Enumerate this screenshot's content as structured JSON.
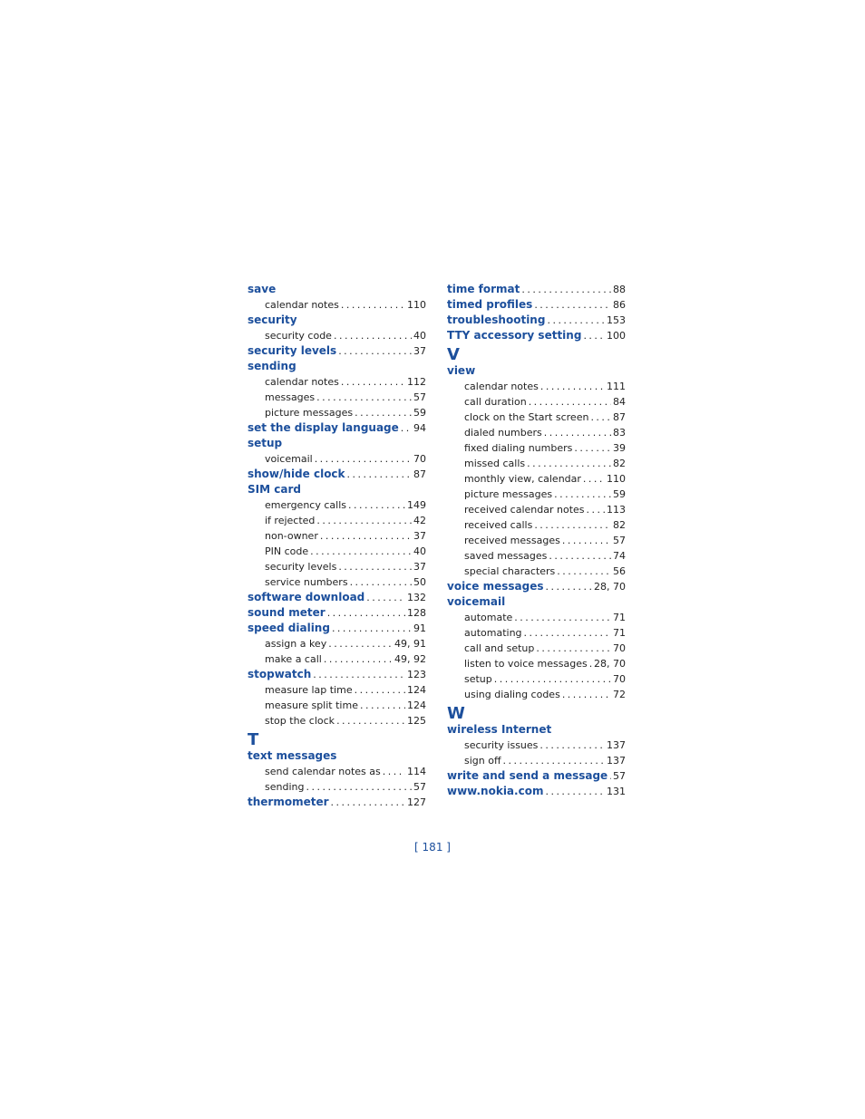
{
  "colors": {
    "heading": "#1c4f9c",
    "text": "#222222"
  },
  "page_number": "[ 181 ]",
  "columns": [
    {
      "entries": [
        {
          "type": "main",
          "term": "save",
          "page": ""
        },
        {
          "type": "sub",
          "term": "calendar notes",
          "page": "110"
        },
        {
          "type": "main",
          "term": "security",
          "page": ""
        },
        {
          "type": "sub",
          "term": "security code",
          "page": "40"
        },
        {
          "type": "main",
          "term": "security levels",
          "page": "37"
        },
        {
          "type": "main",
          "term": "sending",
          "page": ""
        },
        {
          "type": "sub",
          "term": "calendar notes",
          "page": "112"
        },
        {
          "type": "sub",
          "term": "messages",
          "page": "57"
        },
        {
          "type": "sub",
          "term": "picture messages",
          "page": "59"
        },
        {
          "type": "main",
          "term": "set the display language",
          "page": "94"
        },
        {
          "type": "main",
          "term": "setup",
          "page": ""
        },
        {
          "type": "sub",
          "term": "voicemail",
          "page": "70"
        },
        {
          "type": "main",
          "term": "show/hide clock",
          "page": "87"
        },
        {
          "type": "main",
          "term": "SIM card",
          "page": ""
        },
        {
          "type": "sub",
          "term": "emergency calls",
          "page": "149"
        },
        {
          "type": "sub",
          "term": "if rejected",
          "page": "42"
        },
        {
          "type": "sub",
          "term": "non-owner",
          "page": "37"
        },
        {
          "type": "sub",
          "term": "PIN code",
          "page": "40"
        },
        {
          "type": "sub",
          "term": "security levels",
          "page": "37"
        },
        {
          "type": "sub",
          "term": "service numbers",
          "page": "50"
        },
        {
          "type": "main",
          "term": "software download",
          "page": "132"
        },
        {
          "type": "main",
          "term": "sound meter",
          "page": "128"
        },
        {
          "type": "main",
          "term": "speed dialing",
          "page": "91"
        },
        {
          "type": "sub",
          "term": "assign a key",
          "page": "49, 91"
        },
        {
          "type": "sub",
          "term": "make a call",
          "page": "49, 92"
        },
        {
          "type": "main",
          "term": "stopwatch",
          "page": "123"
        },
        {
          "type": "sub",
          "term": "measure lap time",
          "page": "124"
        },
        {
          "type": "sub",
          "term": "measure split time",
          "page": "124"
        },
        {
          "type": "sub",
          "term": "stop the clock",
          "page": "125"
        },
        {
          "type": "letter",
          "term": "T",
          "page": ""
        },
        {
          "type": "main",
          "term": "text messages",
          "page": ""
        },
        {
          "type": "sub",
          "term": "send calendar notes as",
          "page": "114"
        },
        {
          "type": "sub",
          "term": "sending",
          "page": "57"
        },
        {
          "type": "main",
          "term": "thermometer",
          "page": "127"
        }
      ]
    },
    {
      "entries": [
        {
          "type": "main",
          "term": "time format",
          "page": "88"
        },
        {
          "type": "main",
          "term": "timed profiles",
          "page": "86"
        },
        {
          "type": "main",
          "term": "troubleshooting",
          "page": "153"
        },
        {
          "type": "main",
          "term": "TTY accessory setting",
          "page": "100"
        },
        {
          "type": "letter",
          "term": "V",
          "page": ""
        },
        {
          "type": "main",
          "term": "view",
          "page": ""
        },
        {
          "type": "sub",
          "term": "calendar notes",
          "page": "111"
        },
        {
          "type": "sub",
          "term": "call duration",
          "page": "84"
        },
        {
          "type": "sub",
          "term": "clock on the Start screen",
          "page": "87"
        },
        {
          "type": "sub",
          "term": "dialed numbers",
          "page": "83"
        },
        {
          "type": "sub",
          "term": "fixed dialing numbers",
          "page": "39"
        },
        {
          "type": "sub",
          "term": "missed calls",
          "page": "82"
        },
        {
          "type": "sub",
          "term": "monthly view, calendar",
          "page": "110"
        },
        {
          "type": "sub",
          "term": "picture messages",
          "page": "59"
        },
        {
          "type": "sub",
          "term": "received calendar notes",
          "page": "113"
        },
        {
          "type": "sub",
          "term": "received calls",
          "page": "82"
        },
        {
          "type": "sub",
          "term": "received messages",
          "page": "57"
        },
        {
          "type": "sub",
          "term": "saved messages",
          "page": "74"
        },
        {
          "type": "sub",
          "term": "special characters",
          "page": "56"
        },
        {
          "type": "main",
          "term": "voice messages",
          "page": "28, 70"
        },
        {
          "type": "main",
          "term": "voicemail",
          "page": ""
        },
        {
          "type": "sub",
          "term": "automate",
          "page": "71"
        },
        {
          "type": "sub",
          "term": "automating",
          "page": "71"
        },
        {
          "type": "sub",
          "term": "call and setup",
          "page": "70"
        },
        {
          "type": "sub",
          "term": "listen to voice messages",
          "page": "28, 70"
        },
        {
          "type": "sub",
          "term": "setup",
          "page": "70"
        },
        {
          "type": "sub",
          "term": "using dialing codes",
          "page": "72"
        },
        {
          "type": "letter",
          "term": "W",
          "page": ""
        },
        {
          "type": "main",
          "term": "wireless Internet",
          "page": ""
        },
        {
          "type": "sub",
          "term": "security issues",
          "page": "137"
        },
        {
          "type": "sub",
          "term": "sign off",
          "page": "137"
        },
        {
          "type": "main",
          "term": "write and send a message",
          "page": "57"
        },
        {
          "type": "main",
          "term": "www.nokia.com",
          "page": "131"
        }
      ]
    }
  ]
}
